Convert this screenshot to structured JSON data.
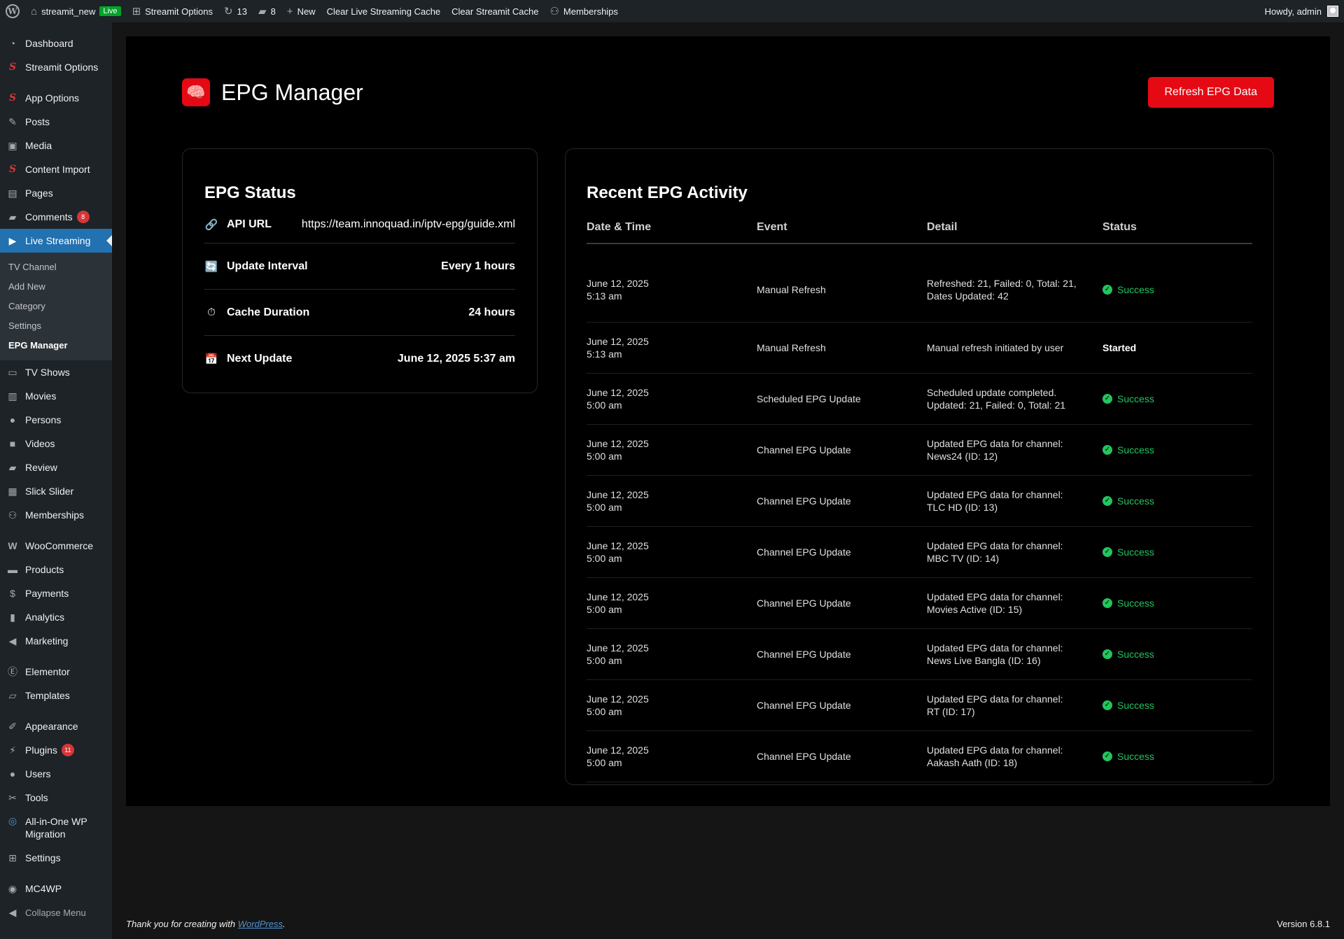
{
  "admin_bar": {
    "site_name": "streamit_new",
    "live_label": "Live",
    "options_label": "Streamit Options",
    "updates_count": "13",
    "comments_count": "8",
    "new_label": "New",
    "clear_live_cache": "Clear Live Streaming Cache",
    "clear_streamit_cache": "Clear Streamit Cache",
    "memberships": "Memberships",
    "howdy": "Howdy, admin"
  },
  "sidebar": {
    "dashboard": "Dashboard",
    "streamit_options": "Streamit Options",
    "app_options": "App Options",
    "posts": "Posts",
    "media": "Media",
    "content_import": "Content Import",
    "pages": "Pages",
    "comments": "Comments",
    "comments_badge": "8",
    "live_streaming": "Live Streaming",
    "sub": {
      "tv_channel": "TV Channel",
      "add_new": "Add New",
      "category": "Category",
      "settings": "Settings",
      "epg_manager": "EPG Manager"
    },
    "tv_shows": "TV Shows",
    "movies": "Movies",
    "persons": "Persons",
    "videos": "Videos",
    "review": "Review",
    "slick_slider": "Slick Slider",
    "memberships": "Memberships",
    "woocommerce": "WooCommerce",
    "products": "Products",
    "payments": "Payments",
    "analytics": "Analytics",
    "marketing": "Marketing",
    "elementor": "Elementor",
    "templates": "Templates",
    "appearance": "Appearance",
    "plugins": "Plugins",
    "plugins_badge": "11",
    "users": "Users",
    "tools": "Tools",
    "migration_line1": "All-in-One WP",
    "migration_line2": "Migration",
    "settings": "Settings",
    "mc4wp": "MC4WP",
    "collapse": "Collapse Menu"
  },
  "page": {
    "title": "EPG Manager",
    "refresh_button": "Refresh EPG Data"
  },
  "status": {
    "title": "EPG Status",
    "api_url_label": "API URL",
    "api_url_value": "https://team.innoquad.in/iptv-epg/guide.xml",
    "interval_label": "Update Interval",
    "interval_value": "Every 1 hours",
    "cache_label": "Cache Duration",
    "cache_value": "24 hours",
    "next_label": "Next Update",
    "next_value": "June 12, 2025 5:37 am"
  },
  "activity": {
    "title": "Recent EPG Activity",
    "headers": {
      "date": "Date & Time",
      "event": "Event",
      "detail": "Detail",
      "status": "Status"
    },
    "rows": [
      {
        "date": "June 12, 2025",
        "time": "5:13 am",
        "event": "Manual Refresh",
        "detail1": "Refreshed: 21, Failed: 0, Total: 21,",
        "detail2": "Dates Updated: 42",
        "status": "Success"
      },
      {
        "date": "June 12, 2025",
        "time": "5:13 am",
        "event": "Manual Refresh",
        "detail1": "Manual refresh initiated by user",
        "detail2": "",
        "status": "Started"
      },
      {
        "date": "June 12, 2025",
        "time": "5:00 am",
        "event": "Scheduled EPG Update",
        "detail1": "Scheduled update completed.",
        "detail2": "Updated: 21, Failed: 0, Total: 21",
        "status": "Success"
      },
      {
        "date": "June 12, 2025",
        "time": "5:00 am",
        "event": "Channel EPG Update",
        "detail1": "Updated EPG data for channel:",
        "detail2": "News24 (ID: 12)",
        "status": "Success"
      },
      {
        "date": "June 12, 2025",
        "time": "5:00 am",
        "event": "Channel EPG Update",
        "detail1": "Updated EPG data for channel:",
        "detail2": "TLC HD (ID: 13)",
        "status": "Success"
      },
      {
        "date": "June 12, 2025",
        "time": "5:00 am",
        "event": "Channel EPG Update",
        "detail1": "Updated EPG data for channel:",
        "detail2": "MBC TV (ID: 14)",
        "status": "Success"
      },
      {
        "date": "June 12, 2025",
        "time": "5:00 am",
        "event": "Channel EPG Update",
        "detail1": "Updated EPG data for channel:",
        "detail2": "Movies Active (ID: 15)",
        "status": "Success"
      },
      {
        "date": "June 12, 2025",
        "time": "5:00 am",
        "event": "Channel EPG Update",
        "detail1": "Updated EPG data for channel:",
        "detail2": "News Live Bangla (ID: 16)",
        "status": "Success"
      },
      {
        "date": "June 12, 2025",
        "time": "5:00 am",
        "event": "Channel EPG Update",
        "detail1": "Updated EPG data for channel:",
        "detail2": "RT (ID: 17)",
        "status": "Success"
      },
      {
        "date": "June 12, 2025",
        "time": "5:00 am",
        "event": "Channel EPG Update",
        "detail1": "Updated EPG data for channel:",
        "detail2": "Aakash Aath (ID: 18)",
        "status": "Success"
      }
    ]
  },
  "footer": {
    "thanks_prefix": "Thank you for creating with ",
    "wordpress_link": "WordPress",
    "thanks_suffix": ".",
    "version": "Version 6.8.1"
  },
  "colors": {
    "accent_red": "#e50914",
    "wp_blue": "#2271b1",
    "success_green": "#22c55e",
    "admin_dark": "#1d2327"
  }
}
